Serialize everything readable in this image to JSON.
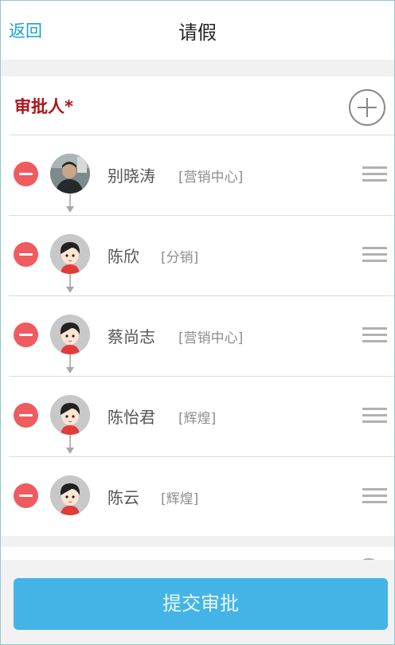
{
  "header": {
    "back_label": "返回",
    "title": "请假"
  },
  "approvers": {
    "label": "审批人*",
    "items": [
      {
        "name": "别晓涛",
        "dept": "[营销中心]",
        "avatar": "photo-avatar"
      },
      {
        "name": "陈欣",
        "dept": "[分销]",
        "avatar": "cartoon-avatar"
      },
      {
        "name": "蔡尚志",
        "dept": "[营销中心]",
        "avatar": "cartoon-avatar"
      },
      {
        "name": "陈怡君",
        "dept": "[辉煌]",
        "avatar": "cartoon-avatar"
      },
      {
        "name": "陈云",
        "dept": "[辉煌]",
        "avatar": "cartoon-avatar"
      }
    ]
  },
  "footer": {
    "submit_label": "提交审批"
  },
  "colors": {
    "accent": "#44b4e6",
    "link": "#1aa3c8",
    "required_label": "#b0141b",
    "remove": "#ef5b5e"
  }
}
